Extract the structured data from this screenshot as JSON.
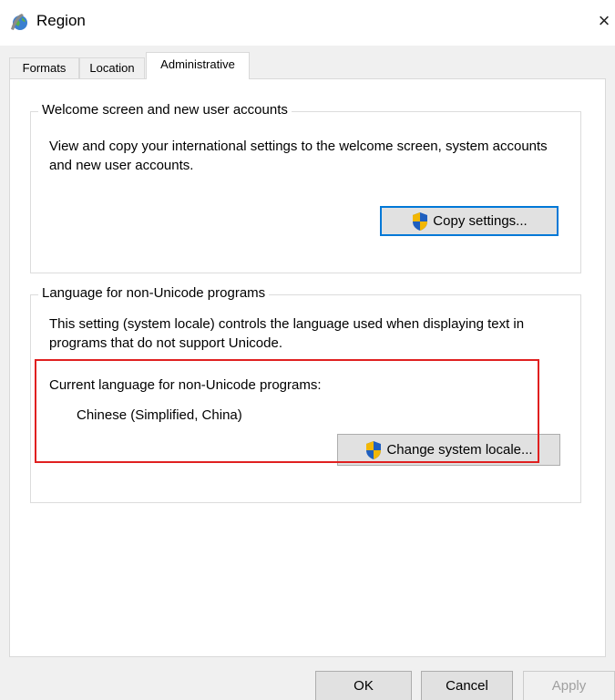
{
  "window": {
    "title": "Region",
    "close_glyph": "×",
    "icon": "globe-region-icon"
  },
  "tabs": [
    {
      "label": "Formats",
      "active": false
    },
    {
      "label": "Location",
      "active": false
    },
    {
      "label": "Administrative",
      "active": true
    }
  ],
  "welcome_group": {
    "legend": "Welcome screen and new user accounts",
    "description": "View and copy your international settings to the welcome screen, system accounts and new user accounts.",
    "copy_button_label": "Copy settings..."
  },
  "nonunicode_group": {
    "legend": "Language for non-Unicode programs",
    "description": "This setting (system locale) controls the language used when displaying text in programs that do not support Unicode.",
    "current_label": "Current language for non-Unicode programs:",
    "current_value": "Chinese (Simplified, China)",
    "change_button_label": "Change system locale..."
  },
  "footer": {
    "ok_label": "OK",
    "cancel_label": "Cancel",
    "apply_label": "Apply"
  },
  "colors": {
    "highlight": "#e02020",
    "focus": "#0078d7",
    "shield_blue": "#1f5fbf",
    "shield_gold": "#f2b705"
  }
}
